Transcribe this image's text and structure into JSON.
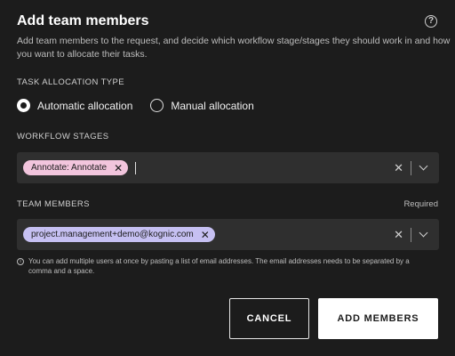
{
  "dialog": {
    "title": "Add team members",
    "help_icon": "question-circle-icon",
    "subtitle": "Add team members to the request, and decide which workflow stage/stages they should work in and how you want to allocate their tasks."
  },
  "task_allocation": {
    "label": "TASK ALLOCATION TYPE",
    "options": [
      {
        "label": "Automatic allocation",
        "selected": true
      },
      {
        "label": "Manual allocation",
        "selected": false
      }
    ]
  },
  "workflow_stages": {
    "label": "WORKFLOW STAGES",
    "chips": [
      {
        "label": "Annotate: Annotate",
        "color": "#f2c5dd"
      }
    ]
  },
  "team_members": {
    "label": "TEAM MEMBERS",
    "required_label": "Required",
    "chips": [
      {
        "label": "project.management+demo@kognic.com",
        "color": "#c6c0f2"
      }
    ],
    "hint": "You can add multiple users at once by pasting a list of email addresses. The email addresses needs to be separated by a comma and a space."
  },
  "buttons": {
    "cancel": "CANCEL",
    "add": "ADD MEMBERS"
  }
}
